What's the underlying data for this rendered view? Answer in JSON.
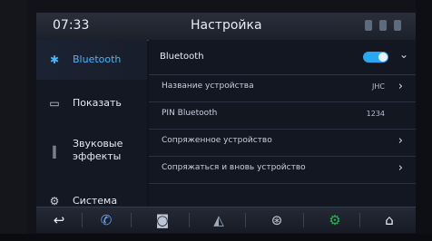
{
  "status": {
    "time": "07:33",
    "title": "Настройка"
  },
  "nav": {
    "items": [
      {
        "label": "Bluetooth",
        "icon": "bluetooth-icon",
        "active": true
      },
      {
        "label": "Показать",
        "icon": "display-icon",
        "active": false
      },
      {
        "label": "Звуковые эффекты",
        "icon": "equalizer-icon",
        "active": false
      },
      {
        "label": "Система",
        "icon": "gear-icon",
        "active": false
      }
    ]
  },
  "panel": {
    "header_label": "Bluetooth",
    "toggle_on": true,
    "rows": [
      {
        "label": "Название устройства",
        "value": "JHC"
      },
      {
        "label": "PIN Bluetooth",
        "value": "1234"
      },
      {
        "label": "Сопряженное устройство",
        "value": ""
      },
      {
        "label": "Сопряжаться и вновь устройство",
        "value": ""
      }
    ]
  },
  "dock": {
    "items": [
      "back-icon",
      "phone-icon",
      "camera-icon",
      "navigation-icon",
      "steering-wheel-icon",
      "settings-icon",
      "home-icon"
    ]
  },
  "colors": {
    "accent": "#43b7ff",
    "toggle": "#2aa7f2",
    "settings_dock": "#22b74c"
  }
}
